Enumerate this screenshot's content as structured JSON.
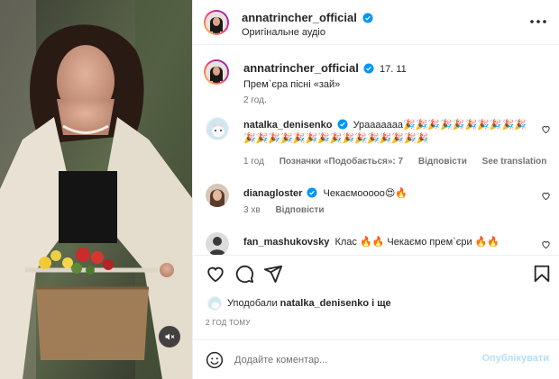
{
  "header": {
    "username": "annatrincher_official",
    "audio_label": "Оригінальне аудіо"
  },
  "caption": {
    "username": "annatrincher_official",
    "date": "17. 11",
    "text": "Прем`єра пісні «зай»",
    "time": "2 год."
  },
  "comments": [
    {
      "username": "natalka_denisenko",
      "text": "Урааааааа🎉🎉🎉🎉🎉🎉🎉🎉🎉🎉🎉🎉🎉🎉🎉🎉🎉🎉🎉🎉🎉🎉🎉🎉🎉",
      "time": "1 год",
      "likes": "Позначки «Подобається»: 7",
      "reply": "Відповісти",
      "translate": "See translation"
    },
    {
      "username": "dianagloster",
      "text": "Чекаємооооо😍🔥",
      "time": "3 хв",
      "reply": "Відповісти"
    },
    {
      "username": "fan_mashukovsky",
      "text": "Клас 🔥🔥 Чекаємо прем`єри 🔥🔥"
    }
  ],
  "liked_by": {
    "prefix": "Уподобали",
    "user": "natalka_denisenko",
    "suffix": "і ще"
  },
  "time_ago": "2 ГОД ТОМУ",
  "comment_box": {
    "placeholder": "Додайте коментар...",
    "post_label": "Опублікувати"
  },
  "colors": {
    "verified": "#0095f6",
    "post_disabled": "#b2dffc",
    "text": "#262626",
    "secondary": "#737373"
  },
  "icons": [
    "heart-icon",
    "comment-icon",
    "share-icon",
    "bookmark-icon",
    "more-icon",
    "mute-icon",
    "emoji-icon",
    "verified-icon"
  ]
}
